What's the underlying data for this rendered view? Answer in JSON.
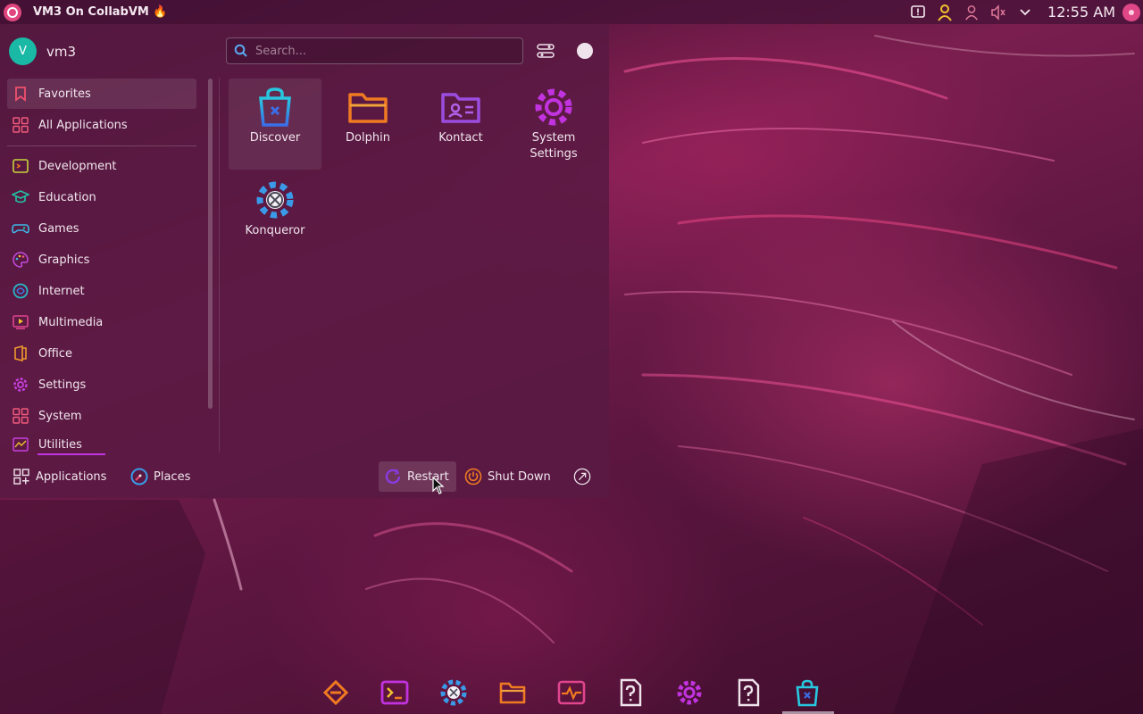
{
  "window_title": "VM3 On CollabVM 🔥",
  "clock": "12:55 AM",
  "user": {
    "initial": "V",
    "name": "vm3"
  },
  "search": {
    "placeholder": "Search..."
  },
  "sidebar": {
    "items": [
      {
        "label": "Favorites",
        "icon": "bookmark-icon",
        "color": "#f0506e"
      },
      {
        "label": "All Applications",
        "icon": "grid-icon",
        "color": "#ef5b7a"
      },
      {
        "label": "Development",
        "icon": "development-icon",
        "color": "#c6d43a"
      },
      {
        "label": "Education",
        "icon": "education-icon",
        "color": "#21c4a5"
      },
      {
        "label": "Games",
        "icon": "gamepad-icon",
        "color": "#3fb7e8"
      },
      {
        "label": "Graphics",
        "icon": "palette-icon",
        "color": "#c44de0"
      },
      {
        "label": "Internet",
        "icon": "globe-icon",
        "color": "#26b8c9"
      },
      {
        "label": "Multimedia",
        "icon": "multimedia-icon",
        "color": "#e0458e"
      },
      {
        "label": "Office",
        "icon": "office-icon",
        "color": "#f09a2c"
      },
      {
        "label": "Settings",
        "icon": "gear-icon",
        "color": "#c840e0"
      },
      {
        "label": "System",
        "icon": "system-icon",
        "color": "#ef5b7a"
      },
      {
        "label": "Utilities",
        "icon": "utilities-icon",
        "color": "#c840e0"
      }
    ]
  },
  "apps": [
    {
      "label": "Discover",
      "icon": "discover-icon"
    },
    {
      "label": "Dolphin",
      "icon": "folder-icon"
    },
    {
      "label": "Kontact",
      "icon": "contact-icon"
    },
    {
      "label": "System Settings",
      "icon": "settings-gear-icon"
    },
    {
      "label": "Konqueror",
      "icon": "konqueror-icon"
    }
  ],
  "bottom": {
    "applications": "Applications",
    "places": "Places",
    "restart": "Restart",
    "shutdown": "Shut Down"
  },
  "colors": {
    "accent": "#c233e0",
    "orange": "#f07a22",
    "pink": "#e04787",
    "teal": "#19b9a6"
  }
}
